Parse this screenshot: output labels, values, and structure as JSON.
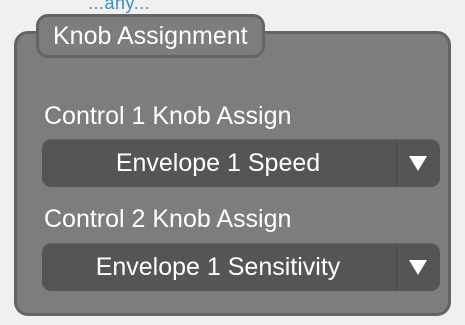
{
  "top_cut_text": "...any...",
  "group": {
    "title": "Knob Assignment"
  },
  "controls": [
    {
      "label": "Control 1 Knob Assign",
      "selected": "Envelope 1 Speed"
    },
    {
      "label": "Control 2 Knob Assign",
      "selected": "Envelope 1 Sensitivity"
    }
  ],
  "colors": {
    "panel": "#7d7d7d",
    "border": "#646464",
    "dropdown": "#555555",
    "text": "#ffffff",
    "top_text": "#3a8fc5"
  },
  "icons": {
    "dropdown_arrow": "chevron-down-icon"
  }
}
